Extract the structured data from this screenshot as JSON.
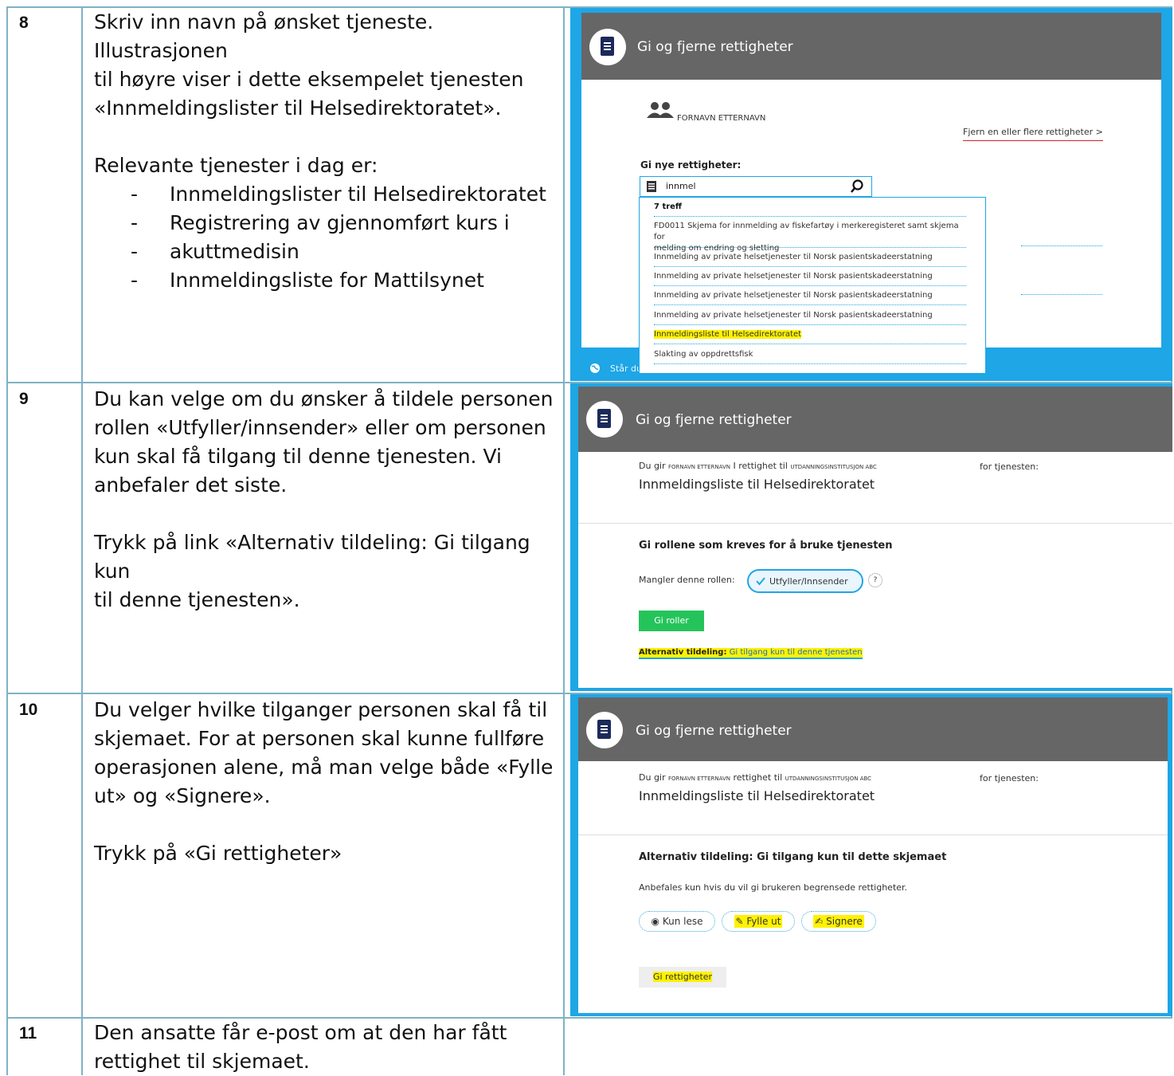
{
  "rows": [
    {
      "number": "8",
      "lines": [
        "Skriv inn navn på ønsket tjeneste. Illustrasjonen",
        "til høyre viser i dette eksempelet tjenesten",
        "«Innmeldingslister til Helsedirektoratet»."
      ],
      "sub_heading": "Relevante tjenester i dag er:",
      "bullets": [
        "Innmeldingslister til Helsedirektoratet",
        "Registrering av gjennomført kurs i",
        "akuttmedisin",
        "Innmeldingsliste for Mattilsynet"
      ]
    },
    {
      "number": "9",
      "lines": [
        "Du kan velge om du ønsker å tildele personen",
        "rollen «Utfyller/innsender» eller om personen",
        "kun skal få tilgang til denne tjenesten. Vi",
        "anbefaler det siste."
      ],
      "lines2": [
        "Trykk på link «Alternativ tildeling: Gi tilgang kun",
        "til denne tjenesten»."
      ]
    },
    {
      "number": "10",
      "lines": [
        "Du velger hvilke tilganger personen skal få til",
        "skjemaet. For at personen skal kunne fullføre",
        "operasjonen alene, må man velge både «Fylle",
        "ut» og «Signere»."
      ],
      "lines2": [
        "Trykk på «Gi rettigheter»"
      ]
    },
    {
      "number": "11",
      "lines": [
        "Den ansatte får e-post om at den har fått",
        "rettighet til skjemaet."
      ]
    }
  ],
  "shot1": {
    "header": "Gi og fjerne rettigheter",
    "person": "FORNAVN ETTERNAVN",
    "remove_link": "Fjern en eller flere rettigheter >",
    "new_rights_label": "Gi nye rettigheter:",
    "search_value": "innmel",
    "hits": "7 treff",
    "results": [
      "FD0011 Skjema for innmelding av fiskefartøy i merkeregisteret samt skjema for",
      "melding om endring og sletting",
      "Innmelding av private helsetjenester til Norsk pasientskadeerstatning",
      "Innmelding av private helsetjenester til Norsk pasientskadeerstatning",
      "Innmelding av private helsetjenester til Norsk pasientskadeerstatning",
      "Innmelding av private helsetjenester til Norsk pasientskadeerstatning",
      "Innmeldingsliste til Helsedirektoratet",
      "Slakting av oppdrettsfisk"
    ],
    "footer_partial": "Står du"
  },
  "shot2": {
    "header": "Gi og fjerne rettigheter",
    "du_gir": "Du gir",
    "person": "FORNAVN ETTERNAVN",
    "rettighet_til": "I rettighet til",
    "org": "UTDANNINGSINSTITUSJON ABC",
    "for_tjenesten": "for tjenesten:",
    "service": "Innmeldingsliste til Helsedirektoratet",
    "section_title": "Gi rollene som kreves for å bruke tjenesten",
    "missing_role": "Mangler denne rollen:",
    "role": "Utfyller/Innsender",
    "help": "?",
    "give_roles": "Gi roller",
    "alt_bold": "Alternativ tildeling:",
    "alt_link": "Gi tilgang kun til denne tjenesten"
  },
  "shot3": {
    "header": "Gi og fjerne rettigheter",
    "du_gir": "Du gir",
    "person": "FORNAVN ETTERNAVN",
    "rettighet_til": "rettighet til",
    "org": "UTDANNINGSINSTITUSJON ABC",
    "for_tjenesten": "for tjenesten:",
    "service": "Innmeldingsliste til Helsedirektoratet",
    "section_title": "Alternativ tildeling: Gi tilgang kun til dette skjemaet",
    "recommend": "Anbefales kun hvis du vil gi brukeren begrensede rettigheter.",
    "read": "Kun lese",
    "fill": "Fylle ut",
    "sign": "Signere",
    "give_rights": "Gi rettigheter"
  }
}
